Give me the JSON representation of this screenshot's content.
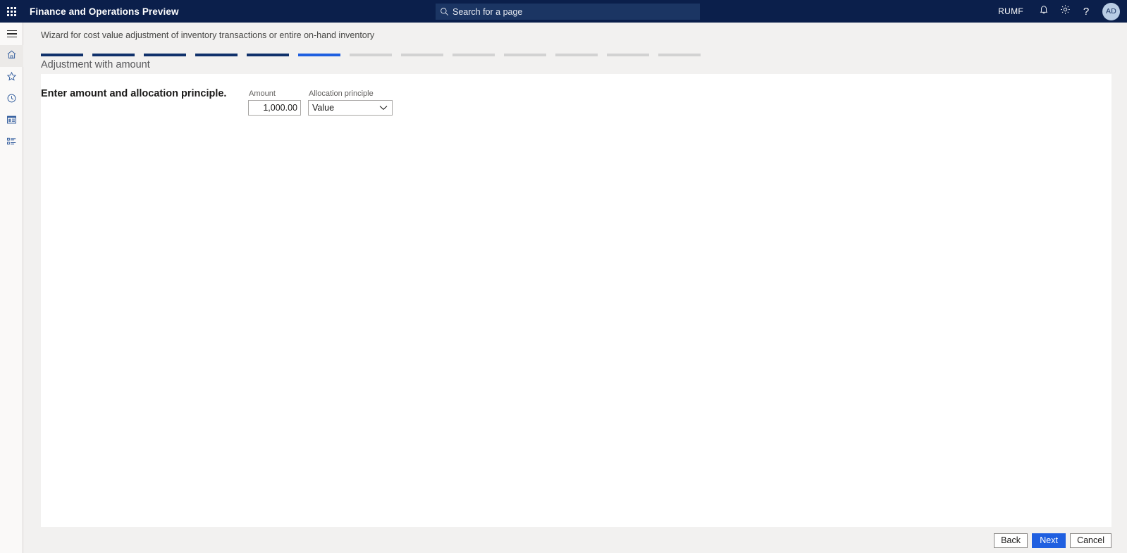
{
  "topbar": {
    "waffle_icon": "waffle-grid-icon",
    "app_title": "Finance and Operations Preview",
    "search": {
      "icon": "search-icon",
      "placeholder": "Search for a page",
      "value": ""
    },
    "company_code": "RUMF",
    "notifications_icon": "bell-icon",
    "settings_icon": "gear-icon",
    "help_icon": "question-mark-icon",
    "help_glyph": "?",
    "avatar_initials": "AD"
  },
  "rail": {
    "menu_icon": "hamburger-icon",
    "items": [
      {
        "name": "home",
        "icon": "home-icon",
        "active": true
      },
      {
        "name": "favorites",
        "icon": "star-icon",
        "active": false
      },
      {
        "name": "recent",
        "icon": "clock-icon",
        "active": false
      },
      {
        "name": "workspaces",
        "icon": "workspace-tile-icon",
        "active": false
      },
      {
        "name": "modules",
        "icon": "list-modules-icon",
        "active": false
      }
    ]
  },
  "wizard": {
    "caption": "Wizard for cost value adjustment of inventory transactions or entire on-hand inventory",
    "step_title": "Adjustment with amount",
    "total_steps": 13,
    "completed_steps": 5,
    "current_step_index": 6,
    "colors": {
      "done": "#10316b",
      "current": "#1f5fe0",
      "pending": "#d2d2d2"
    }
  },
  "content": {
    "heading": "Enter amount and allocation principle.",
    "amount": {
      "label": "Amount",
      "value": "1,000.00"
    },
    "allocation_principle": {
      "label": "Allocation principle",
      "value": "Value",
      "chevron_icon": "chevron-down-icon"
    }
  },
  "footer": {
    "back_label": "Back",
    "next_label": "Next",
    "cancel_label": "Cancel"
  }
}
